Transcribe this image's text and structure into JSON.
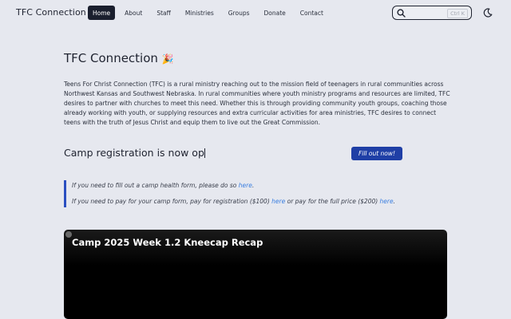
{
  "navbar": {
    "brand": "TFC Connection",
    "links": [
      {
        "label": "Home",
        "active": true
      },
      {
        "label": "About"
      },
      {
        "label": "Staff"
      },
      {
        "label": "Ministries"
      },
      {
        "label": "Groups"
      },
      {
        "label": "Donate"
      },
      {
        "label": "Contact"
      }
    ],
    "search": {
      "shortcut": "Ctrl K",
      "icon": "search-icon"
    },
    "theme_icon": "moon-icon"
  },
  "main": {
    "title": "TFC Connection",
    "title_emoji": "🎉",
    "intro": "Teens For Christ Connection (TFC) is a rural ministry reaching out to the mission field of teenagers in rural communities across Northwest Kansas and Southwest Nebraska. In rural communities where youth ministry programs and resources are limited, TFC desires to partner with churches to meet this need. Whether this is through providing community youth groups, coaching those already working with youth, or supplying resources and extra curricular activities for area ministries, TFC desires to connect teens with the truth of Jesus Christ and equip them to live out the Great Commission.",
    "camp_registration": "Camp registration is now op",
    "fill_out_button": "Fill out now!",
    "callout": {
      "health_prefix": "If you need to fill out a camp health form, please do so ",
      "health_link": "here",
      "health_suffix": ".",
      "pay_prefix": "If you need to pay for your camp form, pay for registration ($100) ",
      "pay_link_1": "here",
      "pay_middle": " or pay for the full price ($200) ",
      "pay_link_2": "here",
      "pay_suffix": "."
    },
    "video": {
      "title": "Camp 2025 Week 1.2 Kneecap Recap"
    }
  },
  "colors": {
    "background": "#e6e8ef",
    "nav_active": "#1a1f2e",
    "button": "#1f3fa6",
    "link": "#3a7ee0",
    "callout_border": "#2b4fc1"
  }
}
